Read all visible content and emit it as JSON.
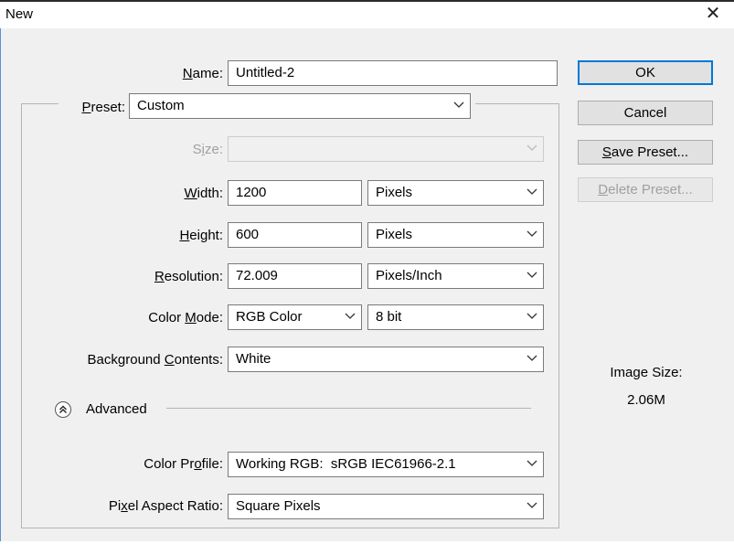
{
  "window": {
    "title": "New",
    "close_glyph": "✕"
  },
  "name": {
    "label_u": "N",
    "label_rest": "ame:",
    "value": "Untitled-2"
  },
  "preset": {
    "label_u": "P",
    "label_rest": "reset:",
    "value": "Custom"
  },
  "size": {
    "label_pre": "S",
    "label_u": "i",
    "label_rest": "ze:",
    "value": ""
  },
  "width": {
    "label_u": "W",
    "label_rest": "idth:",
    "value": "1200",
    "unit": "Pixels"
  },
  "height": {
    "label_u": "H",
    "label_rest": "eight:",
    "value": "600",
    "unit": "Pixels"
  },
  "resolution": {
    "label_u": "R",
    "label_rest": "esolution:",
    "value": "72.009",
    "unit": "Pixels/Inch"
  },
  "color_mode": {
    "label_pre": "Color ",
    "label_u": "M",
    "label_rest": "ode:",
    "value": "RGB Color",
    "depth": "8 bit"
  },
  "background": {
    "label_pre": "Background ",
    "label_u": "C",
    "label_rest": "ontents:",
    "value": "White"
  },
  "advanced": {
    "label": "Advanced",
    "icon": "chevron-double-up-icon"
  },
  "color_profile": {
    "label_pre": "Color Pr",
    "label_u": "o",
    "label_rest": "file:",
    "value": "Working RGB:  sRGB IEC61966-2.1"
  },
  "pixel_aspect": {
    "label_pre": "Pi",
    "label_u": "x",
    "label_rest": "el Aspect Ratio:",
    "value": "Square Pixels"
  },
  "buttons": {
    "ok": "OK",
    "cancel": "Cancel",
    "save_u": "S",
    "save_rest": "ave Preset...",
    "delete_u": "D",
    "delete_rest": "elete Preset..."
  },
  "image_size": {
    "label": "Image Size:",
    "value": "2.06M"
  },
  "colors": {
    "accent": "#0078d7",
    "window_bg": "#f0f0f0",
    "disabled_text": "#a0a0a0"
  }
}
